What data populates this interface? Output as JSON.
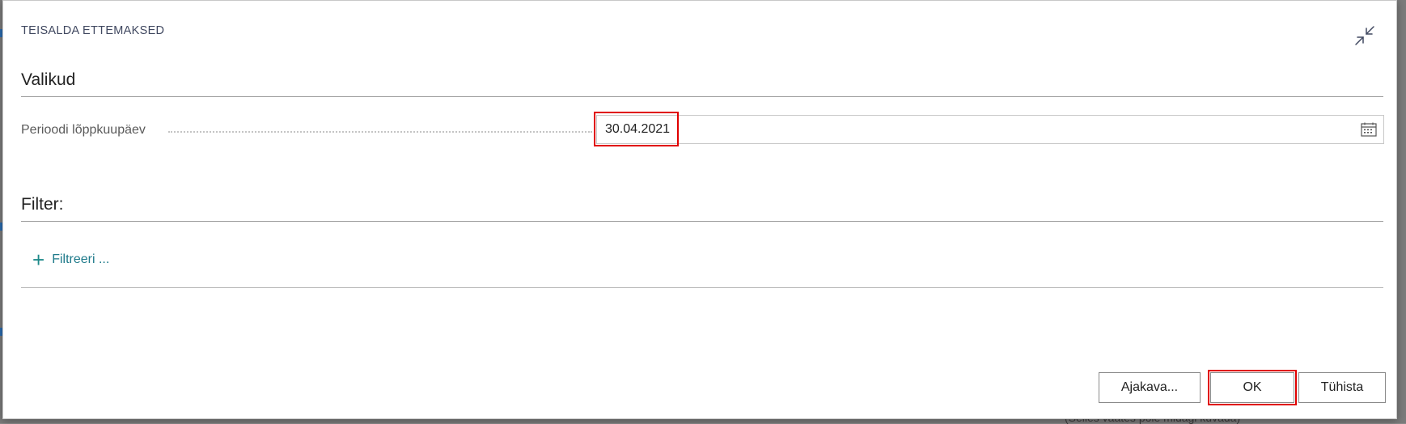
{
  "background": {
    "partial_text": "(Selles vaates pole midagi kuvada)"
  },
  "dialog": {
    "title": "TEISALDA ETTEMAKSED",
    "collapse_icon": "collapse-arrows-icon"
  },
  "options_section": {
    "title": "Valikud",
    "field_label": "Perioodi lõppkuupäev",
    "field_value": "30.04.2021",
    "calendar_icon": "calendar-icon"
  },
  "filter_section": {
    "title": "Filter:",
    "add_filter_label": "Filtreeri ...",
    "add_icon": "plus-icon"
  },
  "footer": {
    "schedule_label": "Ajakava...",
    "ok_label": "OK",
    "cancel_label": "Tühista"
  },
  "colors": {
    "accent": "#1e7a8a",
    "highlight": "#e00000"
  }
}
